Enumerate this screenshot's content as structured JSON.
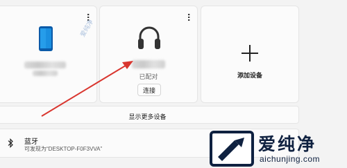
{
  "cards": {
    "headphones": {
      "status": "已配对",
      "connect_label": "连接"
    },
    "add": {
      "label": "添加设备"
    }
  },
  "show_more": "显示更多设备",
  "bluetooth": {
    "title": "蓝牙",
    "subtitle": "可发现为“DESKTOP-F0F3VVA”"
  },
  "watermark": {
    "small": "爱纯净",
    "logo_text": "爱纯净",
    "logo_url": "aichunjing.com"
  },
  "colors": {
    "accent": "#0a66c2",
    "arrow": "#d9362f"
  }
}
